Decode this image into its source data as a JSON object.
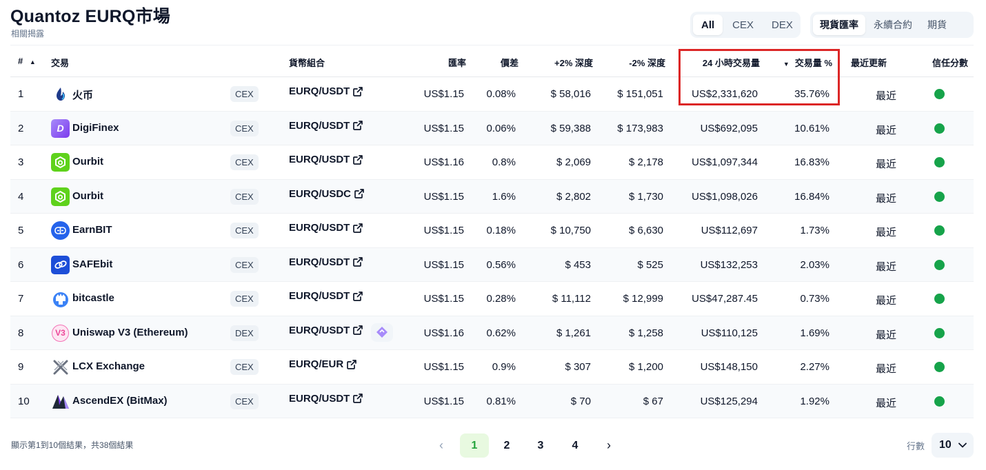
{
  "header": {
    "title": "Quantoz EURQ市場",
    "subtitle": "相關揭露"
  },
  "filters": {
    "market_types": [
      "All",
      "CEX",
      "DEX"
    ],
    "market_types_active": "All",
    "contract_types": [
      "現貨匯率",
      "永續合約",
      "期貨"
    ],
    "contract_types_active": "現貨匯率"
  },
  "table": {
    "columns": {
      "rank": "#",
      "exchange": "交易",
      "pair": "貨幣組合",
      "rate": "匯率",
      "spread": "價差",
      "depth_plus": "+2% 深度",
      "depth_minus": "-2% 深度",
      "volume": "24 小時交易量",
      "volume_pct": "交易量 %",
      "updated": "最近更新",
      "trust": "信任分數"
    },
    "rows": [
      {
        "rank": "1",
        "name": "火币",
        "logo": "huobi-logo",
        "type": "CEX",
        "pair": "EURQ/USDT",
        "rate": "US$1.15",
        "spread": "0.08%",
        "depth_plus": "$ 58,016",
        "depth_minus": "$ 151,051",
        "volume": "US$2,331,620",
        "volume_pct": "35.76%",
        "updated": "最近",
        "trust": "green"
      },
      {
        "rank": "2",
        "name": "DigiFinex",
        "logo": "digifinex-logo",
        "type": "CEX",
        "pair": "EURQ/USDT",
        "rate": "US$1.15",
        "spread": "0.06%",
        "depth_plus": "$ 59,388",
        "depth_minus": "$ 173,983",
        "volume": "US$692,095",
        "volume_pct": "10.61%",
        "updated": "最近",
        "trust": "green"
      },
      {
        "rank": "3",
        "name": "Ourbit",
        "logo": "ourbit-logo",
        "type": "CEX",
        "pair": "EURQ/USDT",
        "rate": "US$1.16",
        "spread": "0.8%",
        "depth_plus": "$ 2,069",
        "depth_minus": "$ 2,178",
        "volume": "US$1,097,344",
        "volume_pct": "16.83%",
        "updated": "最近",
        "trust": "green"
      },
      {
        "rank": "4",
        "name": "Ourbit",
        "logo": "ourbit-logo",
        "type": "CEX",
        "pair": "EURQ/USDC",
        "rate": "US$1.15",
        "spread": "1.6%",
        "depth_plus": "$ 2,802",
        "depth_minus": "$ 1,730",
        "volume": "US$1,098,026",
        "volume_pct": "16.84%",
        "updated": "最近",
        "trust": "green"
      },
      {
        "rank": "5",
        "name": "EarnBIT",
        "logo": "earnbit-logo",
        "type": "CEX",
        "pair": "EURQ/USDT",
        "rate": "US$1.15",
        "spread": "0.18%",
        "depth_plus": "$ 10,750",
        "depth_minus": "$ 6,630",
        "volume": "US$112,697",
        "volume_pct": "1.73%",
        "updated": "最近",
        "trust": "green"
      },
      {
        "rank": "6",
        "name": "SAFEbit",
        "logo": "safebit-logo",
        "type": "CEX",
        "pair": "EURQ/USDT",
        "rate": "US$1.15",
        "spread": "0.56%",
        "depth_plus": "$ 453",
        "depth_minus": "$ 525",
        "volume": "US$132,253",
        "volume_pct": "2.03%",
        "updated": "最近",
        "trust": "green"
      },
      {
        "rank": "7",
        "name": "bitcastle",
        "logo": "bitcastle-logo",
        "type": "CEX",
        "pair": "EURQ/USDT",
        "rate": "US$1.15",
        "spread": "0.28%",
        "depth_plus": "$ 11,112",
        "depth_minus": "$ 12,999",
        "volume": "US$47,287.45",
        "volume_pct": "0.73%",
        "updated": "最近",
        "trust": "green"
      },
      {
        "rank": "8",
        "name": "Uniswap V3 (Ethereum)",
        "logo": "uniswap-logo",
        "type": "DEX",
        "pair": "EURQ/USDT",
        "rate": "US$1.16",
        "spread": "0.62%",
        "depth_plus": "$ 1,261",
        "depth_minus": "$ 1,258",
        "volume": "US$110,125",
        "volume_pct": "1.69%",
        "updated": "最近",
        "trust": "green"
      },
      {
        "rank": "9",
        "name": "LCX Exchange",
        "logo": "lcx-logo",
        "type": "CEX",
        "pair": "EURQ/EUR",
        "rate": "US$1.15",
        "spread": "0.9%",
        "depth_plus": "$ 307",
        "depth_minus": "$ 1,200",
        "volume": "US$148,150",
        "volume_pct": "2.27%",
        "updated": "最近",
        "trust": "green"
      },
      {
        "rank": "10",
        "name": "AscendEX (BitMax)",
        "logo": "ascendex-logo",
        "type": "CEX",
        "pair": "EURQ/USDT",
        "rate": "US$1.15",
        "spread": "0.81%",
        "depth_plus": "$ 70",
        "depth_minus": "$ 67",
        "volume": "US$125,294",
        "volume_pct": "1.92%",
        "updated": "最近",
        "trust": "green"
      }
    ]
  },
  "footer": {
    "results_text": "顯示第1到10個結果，共38個結果",
    "pages": [
      "1",
      "2",
      "3",
      "4"
    ],
    "current_page": "1",
    "rows_label": "行數",
    "rows_value": "10"
  },
  "colors": {
    "trust_green": "#16a34a",
    "highlight_red": "#dc2626",
    "active_page_bg": "#e8f9e0",
    "active_page_text": "#22a33a"
  }
}
